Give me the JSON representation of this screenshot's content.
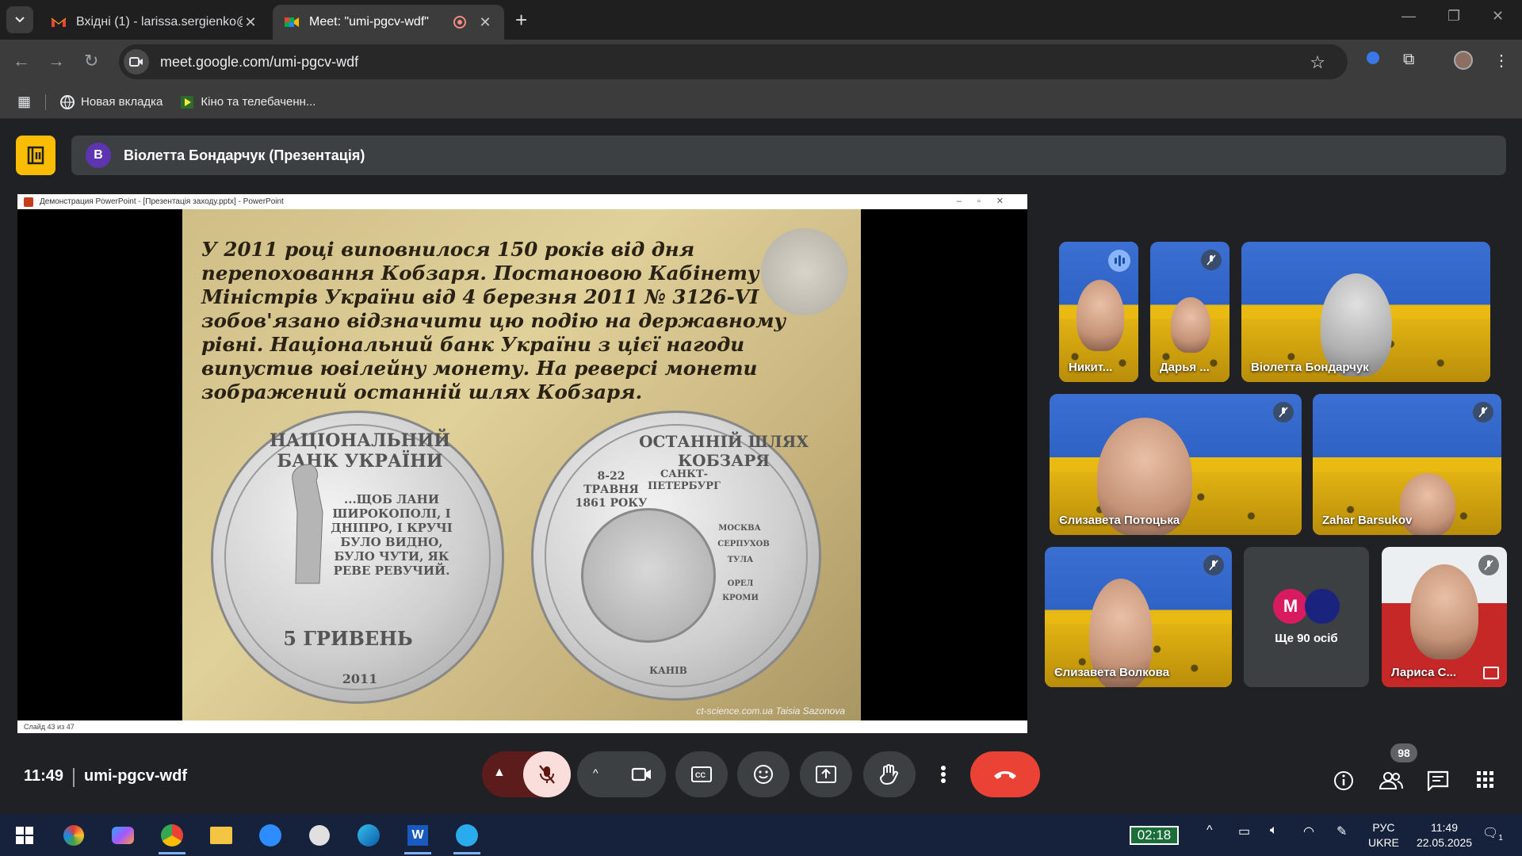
{
  "browser": {
    "tabs": [
      {
        "title": "Вхідні (1) - larissa.sergienko@g",
        "favicon": "gmail-icon",
        "active": false
      },
      {
        "title": "Meet: \"umi-pgcv-wdf\"",
        "favicon": "meet-icon",
        "active": true
      }
    ],
    "url": "meet.google.com/umi-pgcv-wdf",
    "bookmarks": [
      {
        "label": "Новая вкладка",
        "icon": "globe-icon"
      },
      {
        "label": "Кіно та телебаченн...",
        "icon": "video-icon"
      }
    ]
  },
  "presentation": {
    "presenter_initial": "В",
    "banner_title": "Віолетта Бондарчук (Презентація)",
    "window_title": "Демонстрация PowerPoint - [Презентація заходу.pptx] - PowerPoint",
    "slide_text": "У 2011 році виповнилося 150 років від дня перепоховання Кобзаря. Постановою Кабінету Міністрів України від 4 березня 2011 № 3126-VI зобов'язано відзначити цю подію на державному рівні. Національний банк України з цієї нагоди випустив ювілейну монету. На реверсі монети зображений останній шлях Кобзаря.",
    "coin_left": {
      "top_text": "НАЦІОНАЛЬНИЙ БАНК УКРАЇНИ",
      "quote": "...ЩОБ ЛАНИ ШИРОКОПОЛІ, І ДНІПРО, І КРУЧІ БУЛО ВИДНО, БУЛО ЧУТИ, ЯК РЕВЕ РЕВУЧИЙ.",
      "denomination": "5 ГРИВЕНЬ",
      "year": "2011"
    },
    "coin_right": {
      "top_text": "ОСТАННІЙ ШЛЯХ КОБЗАРЯ",
      "dates": "8-22 ТРАВНЯ 1861 РОКУ",
      "city_start": "САНКТ-ПЕТЕРБУРГ",
      "city_end": "КАНІВ",
      "cities": [
        "МОСКВА",
        "СЕРПУХОВ",
        "ТУЛА",
        "ОРЕЛ",
        "КРОМИ"
      ]
    },
    "credit": "ct-science.com.ua   Taisia Sazonova",
    "status": "Слайд 43 из 47"
  },
  "participants": [
    {
      "name": "Никит...",
      "muted": false,
      "speaking": true
    },
    {
      "name": "Дарья ...",
      "muted": true
    },
    {
      "name": "Віолетта Бондарчук",
      "muted": false
    },
    {
      "name": "Єлизавета Потоцька",
      "muted": true
    },
    {
      "name": "Zahar Barsukov",
      "muted": true
    },
    {
      "name": "Єлизавета Волкова",
      "muted": true
    },
    {
      "name": "Лариса С...",
      "muted": true
    }
  ],
  "more_participants": {
    "initial": "M",
    "label": "Ще 90 осіб",
    "color": "#d81b60"
  },
  "controls": {
    "time": "11:49",
    "meeting_code": "umi-pgcv-wdf",
    "people_count": "98",
    "end_call_color": "#ea4335",
    "mic_off_color": "#f9dedc"
  },
  "taskbar": {
    "timer": "02:18",
    "lang_line1": "РУС",
    "lang_line2": "UKRE",
    "time": "11:49",
    "date": "22.05.2025",
    "notification_count": "1"
  }
}
